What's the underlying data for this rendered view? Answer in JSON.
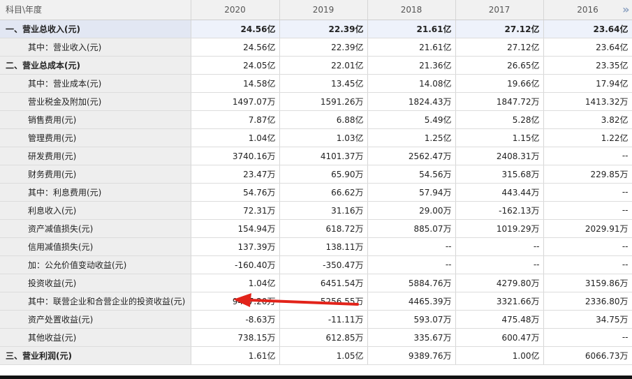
{
  "header": {
    "corner": "科目\\年度",
    "years": [
      "2020",
      "2019",
      "2018",
      "2017",
      "2016"
    ],
    "more_icon": "double-chevron-right-icon"
  },
  "rows": [
    {
      "label": "一、营业总收入(元)",
      "values": [
        "24.56亿",
        "22.39亿",
        "21.61亿",
        "27.12亿",
        "23.64亿"
      ]
    },
    {
      "label": "其中：营业收入(元)",
      "values": [
        "24.56亿",
        "22.39亿",
        "21.61亿",
        "27.12亿",
        "23.64亿"
      ]
    },
    {
      "label": "二、营业总成本(元)",
      "values": [
        "24.05亿",
        "22.01亿",
        "21.36亿",
        "26.65亿",
        "23.35亿"
      ]
    },
    {
      "label": "其中：营业成本(元)",
      "values": [
        "14.58亿",
        "13.45亿",
        "14.08亿",
        "19.66亿",
        "17.94亿"
      ]
    },
    {
      "label": "营业税金及附加(元)",
      "values": [
        "1497.07万",
        "1591.26万",
        "1824.43万",
        "1847.72万",
        "1413.32万"
      ]
    },
    {
      "label": "销售费用(元)",
      "values": [
        "7.87亿",
        "6.88亿",
        "5.49亿",
        "5.28亿",
        "3.82亿"
      ]
    },
    {
      "label": "管理费用(元)",
      "values": [
        "1.04亿",
        "1.03亿",
        "1.25亿",
        "1.15亿",
        "1.22亿"
      ]
    },
    {
      "label": "研发费用(元)",
      "values": [
        "3740.16万",
        "4101.37万",
        "2562.47万",
        "2408.31万",
        "--"
      ]
    },
    {
      "label": "财务费用(元)",
      "values": [
        "23.47万",
        "65.90万",
        "54.56万",
        "315.68万",
        "229.85万"
      ]
    },
    {
      "label": "其中：利息费用(元)",
      "values": [
        "54.76万",
        "66.62万",
        "57.94万",
        "443.44万",
        "--"
      ]
    },
    {
      "label": "利息收入(元)",
      "values": [
        "72.31万",
        "31.16万",
        "29.00万",
        "-162.13万",
        "--"
      ]
    },
    {
      "label": "资产减值损失(元)",
      "values": [
        "154.94万",
        "618.72万",
        "885.07万",
        "1019.29万",
        "2029.91万"
      ]
    },
    {
      "label": "信用减值损失(元)",
      "values": [
        "137.39万",
        "138.11万",
        "--",
        "--",
        "--"
      ]
    },
    {
      "label": "加：公允价值变动收益(元)",
      "values": [
        "-160.40万",
        "-350.47万",
        "--",
        "--",
        "--"
      ]
    },
    {
      "label": "投资收益(元)",
      "values": [
        "1.04亿",
        "6451.54万",
        "5884.76万",
        "4279.80万",
        "3159.86万"
      ]
    },
    {
      "label": "其中：联营企业和合营企业的投资收益(元)",
      "values": [
        "9497.20万",
        "5256.55万",
        "4465.39万",
        "3321.66万",
        "2336.80万"
      ]
    },
    {
      "label": "资产处置收益(元)",
      "values": [
        "-8.63万",
        "-11.11万",
        "593.07万",
        "475.48万",
        "34.75万"
      ]
    },
    {
      "label": "其他收益(元)",
      "values": [
        "738.15万",
        "612.85万",
        "335.67万",
        "600.47万",
        "--"
      ]
    },
    {
      "label": "三、营业利润(元)",
      "values": [
        "1.61亿",
        "1.05亿",
        "9389.76万",
        "1.00亿",
        "6066.73万"
      ]
    }
  ],
  "annotation": {
    "color": "#e2231a",
    "icon": "red-arrow-annotation"
  }
}
